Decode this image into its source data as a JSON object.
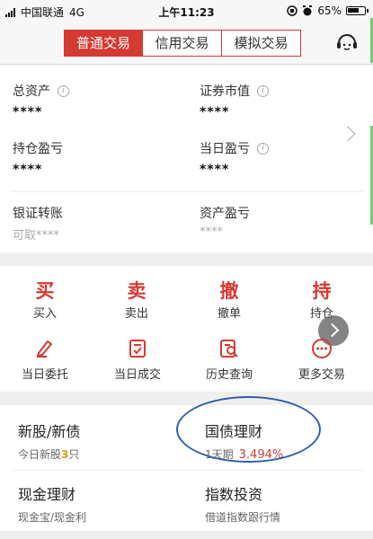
{
  "status_bar": {
    "carrier": "中国联通",
    "network": "4G",
    "time": "上午11:23",
    "battery": "65%"
  },
  "tabs": [
    {
      "label": "普通交易",
      "active": true
    },
    {
      "label": "信用交易",
      "active": false
    },
    {
      "label": "模拟交易",
      "active": false
    }
  ],
  "assets": {
    "total_assets": {
      "label": "总资产",
      "value": "****"
    },
    "market_value": {
      "label": "证券市值",
      "value": "****"
    },
    "position_pl": {
      "label": "持仓盈亏",
      "value": "****"
    },
    "daily_pl": {
      "label": "当日盈亏",
      "value": "****"
    },
    "bank_transfer": {
      "label": "银证转账",
      "sub": "可取****"
    },
    "asset_pl": {
      "label": "资产盈亏",
      "sub": "****"
    }
  },
  "trade_actions": [
    {
      "char": "买",
      "label": "买入"
    },
    {
      "char": "卖",
      "label": "卖出"
    },
    {
      "char": "撤",
      "label": "撤单"
    },
    {
      "char": "持",
      "label": "持仓"
    }
  ],
  "functions": [
    {
      "label": "当日委托",
      "icon": "entrust-icon"
    },
    {
      "label": "当日成交",
      "icon": "deal-icon"
    },
    {
      "label": "历史查询",
      "icon": "history-search-icon"
    },
    {
      "label": "更多交易",
      "icon": "more-icon"
    }
  ],
  "products": {
    "ipo": {
      "title": "新股/新债",
      "sub_prefix": "今日新股",
      "count": "3",
      "sub_suffix": "只"
    },
    "treasury": {
      "title": "国债理财",
      "term": "1天期",
      "rate": "3.494%"
    },
    "cash": {
      "title": "现金理财",
      "sub": "现金宝/现金利"
    },
    "index": {
      "title": "指数投资",
      "sub": "借道指数跟行情"
    }
  },
  "colors": {
    "accent": "#d43a32",
    "highlight": "#d4a000",
    "annotation": "#2c5fa8"
  }
}
